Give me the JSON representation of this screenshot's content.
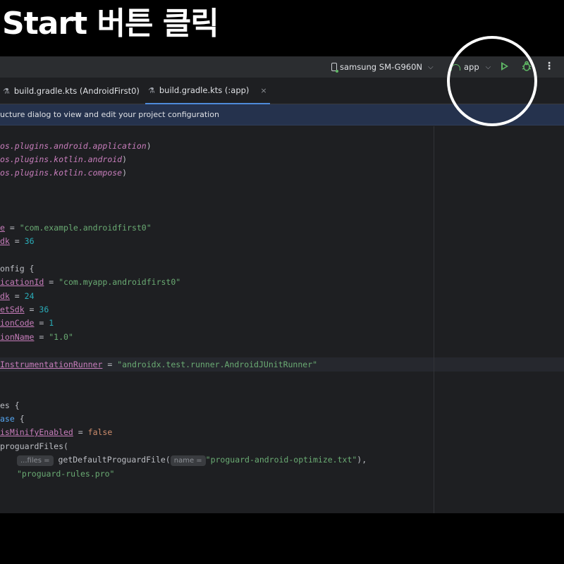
{
  "caption": "Start 버튼 클릭",
  "toolbar": {
    "device": "samsung SM-G960N",
    "config": "app",
    "chevron": "⌵",
    "run_icon": "run-icon",
    "debug_icon": "debug-icon",
    "more_icon": "⋮"
  },
  "tabs": [
    {
      "label": "build.gradle.kts (AndroidFirst0)",
      "active": false
    },
    {
      "label": "build.gradle.kts (:app)",
      "active": true,
      "close": "×"
    }
  ],
  "banner": "ucture dialog to view and edit your project configuration",
  "code": {
    "l1": [
      "os.plugins.android.application",
      ")"
    ],
    "l2": [
      "os.plugins.kotlin.android",
      ")"
    ],
    "l3": [
      "os.plugins.kotlin.compose",
      ")"
    ],
    "l4": [
      "e",
      " = ",
      "\"com.example.androidfirst0\""
    ],
    "l5": [
      "dk",
      " = ",
      "36"
    ],
    "l6": "onfig {",
    "l7": [
      "icationId",
      " = ",
      "\"com.myapp.androidfirst0\""
    ],
    "l8": [
      "dk",
      " = ",
      "24"
    ],
    "l9": [
      "etSdk",
      " = ",
      "36"
    ],
    "l10": [
      "ionCode",
      " = ",
      "1"
    ],
    "l11": [
      "ionName",
      " = ",
      "\"1.0\""
    ],
    "l12": [
      "InstrumentationRunner",
      " = ",
      "\"androidx.test.runner.AndroidJUnitRunner\""
    ],
    "l13": "es {",
    "l14": [
      "ase",
      " {"
    ],
    "l15": [
      "isMinifyEnabled",
      " = ",
      "false"
    ],
    "l16": "proguardFiles(",
    "l17_hint": "...files =",
    "l17_fn": "getDefaultProguardFile(",
    "l17_hint2": "name =",
    "l17_str": "\"proguard-android-optimize.txt\"",
    "l17_end": "),",
    "l18": "\"proguard-rules.pro\""
  },
  "colors": {
    "accent_green": "#5fb865",
    "tab_active_underline": "#4e8ad9",
    "banner_bg": "#25324d",
    "annotation_circle": "#ffffff"
  }
}
